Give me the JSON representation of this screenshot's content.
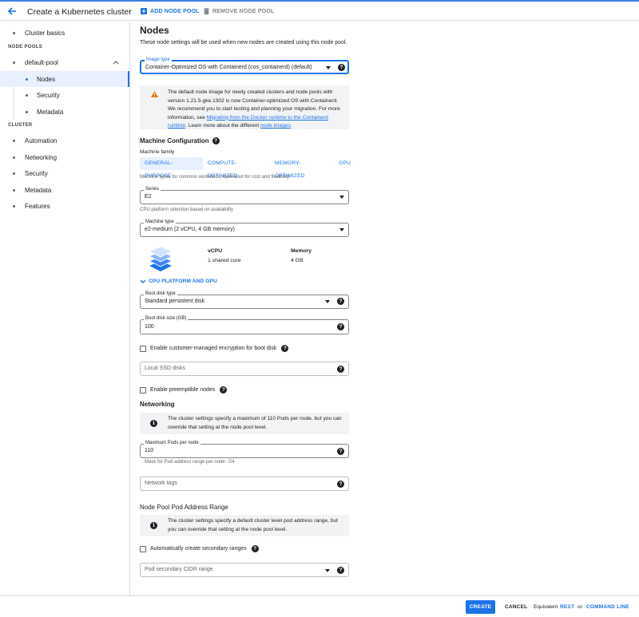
{
  "header": {
    "title": "Create a Kubernetes cluster",
    "add_node_pool": "ADD NODE POOL",
    "remove_node_pool": "REMOVE NODE POOL"
  },
  "sidebar": {
    "cluster_basics": "Cluster basics",
    "node_pools_section": "NODE POOLS",
    "pool_name": "default-pool",
    "pool_items": [
      "Nodes",
      "Security",
      "Metadata"
    ],
    "cluster_section": "CLUSTER",
    "cluster_items": [
      "Automation",
      "Networking",
      "Security",
      "Metadata",
      "Features"
    ]
  },
  "main": {
    "heading": "Nodes",
    "description": "These node settings will be used when new nodes are created using this node pool.",
    "image_type": {
      "label": "Image type",
      "value": "Container-Optimized OS with Containerd (cos_containerd) (default)"
    },
    "warning": {
      "text_before": "The default node image for newly created clusters and node pools with version 1.21.5-gke.1302 is now Container-optimized OS with Containerd. We recommend you to start testing and planning your migration. For more information, see ",
      "link1": "Migrating from the Docker runtime to the Containerd runtime",
      "text_middle": ". Learn more about the different ",
      "link2": "node images",
      "text_after": "."
    },
    "machine_config": {
      "heading": "Machine Configuration",
      "family_label": "Machine family",
      "tabs": [
        "GENERAL-PURPOSE",
        "COMPUTE-OPTIMIZED",
        "MEMORY-OPTIMIZED",
        "GPU"
      ],
      "family_hint": "Machine types for common workloads, optimized for cost and flexibility",
      "series": {
        "label": "Series",
        "value": "E2"
      },
      "series_hint": "CPU platform selection based on availability",
      "machine_type": {
        "label": "Machine type",
        "value": "e2-medium (2 vCPU, 4 GB memory)"
      },
      "vcpu_label": "vCPU",
      "vcpu_value": "1 shared core",
      "memory_label": "Memory",
      "memory_value": "4 GB",
      "expander": "CPU PLATFORM AND GPU"
    },
    "boot_disk_type": {
      "label": "Boot disk type",
      "value": "Standard persistent disk"
    },
    "boot_disk_size": {
      "label": "Boot disk size (GB)",
      "value": "100"
    },
    "cmek_checkbox": "Enable customer-managed encryption for boot disk",
    "local_ssd_placeholder": "Local SSD disks",
    "preemptible_checkbox": "Enable preemptible nodes",
    "networking": {
      "heading": "Networking",
      "info": "The cluster settings specify a maximum of 110 Pods per node, but you can override that setting at the node pool level.",
      "max_pods": {
        "label": "Maximum Pods per node",
        "value": "110"
      },
      "max_pods_hint": "Mask for Pod address range per node: /24",
      "network_tags_placeholder": "Network tags"
    },
    "pod_range": {
      "heading": "Node Pool Pod Address Range",
      "info": "The cluster settings specify a default cluster level pod address range, but you can override that setting at the node pool level.",
      "auto_checkbox": "Automatically create secondary ranges",
      "cidr_placeholder": "Pod secondary CIDR range"
    }
  },
  "footer": {
    "create": "CREATE",
    "cancel": "CANCEL",
    "equivalent": "Equivalent",
    "rest": "REST",
    "or": "or",
    "command_line": "COMMAND LINE"
  },
  "colors": {
    "accent": "#1a73e8",
    "warning": "#e37400",
    "text": "#202124"
  }
}
